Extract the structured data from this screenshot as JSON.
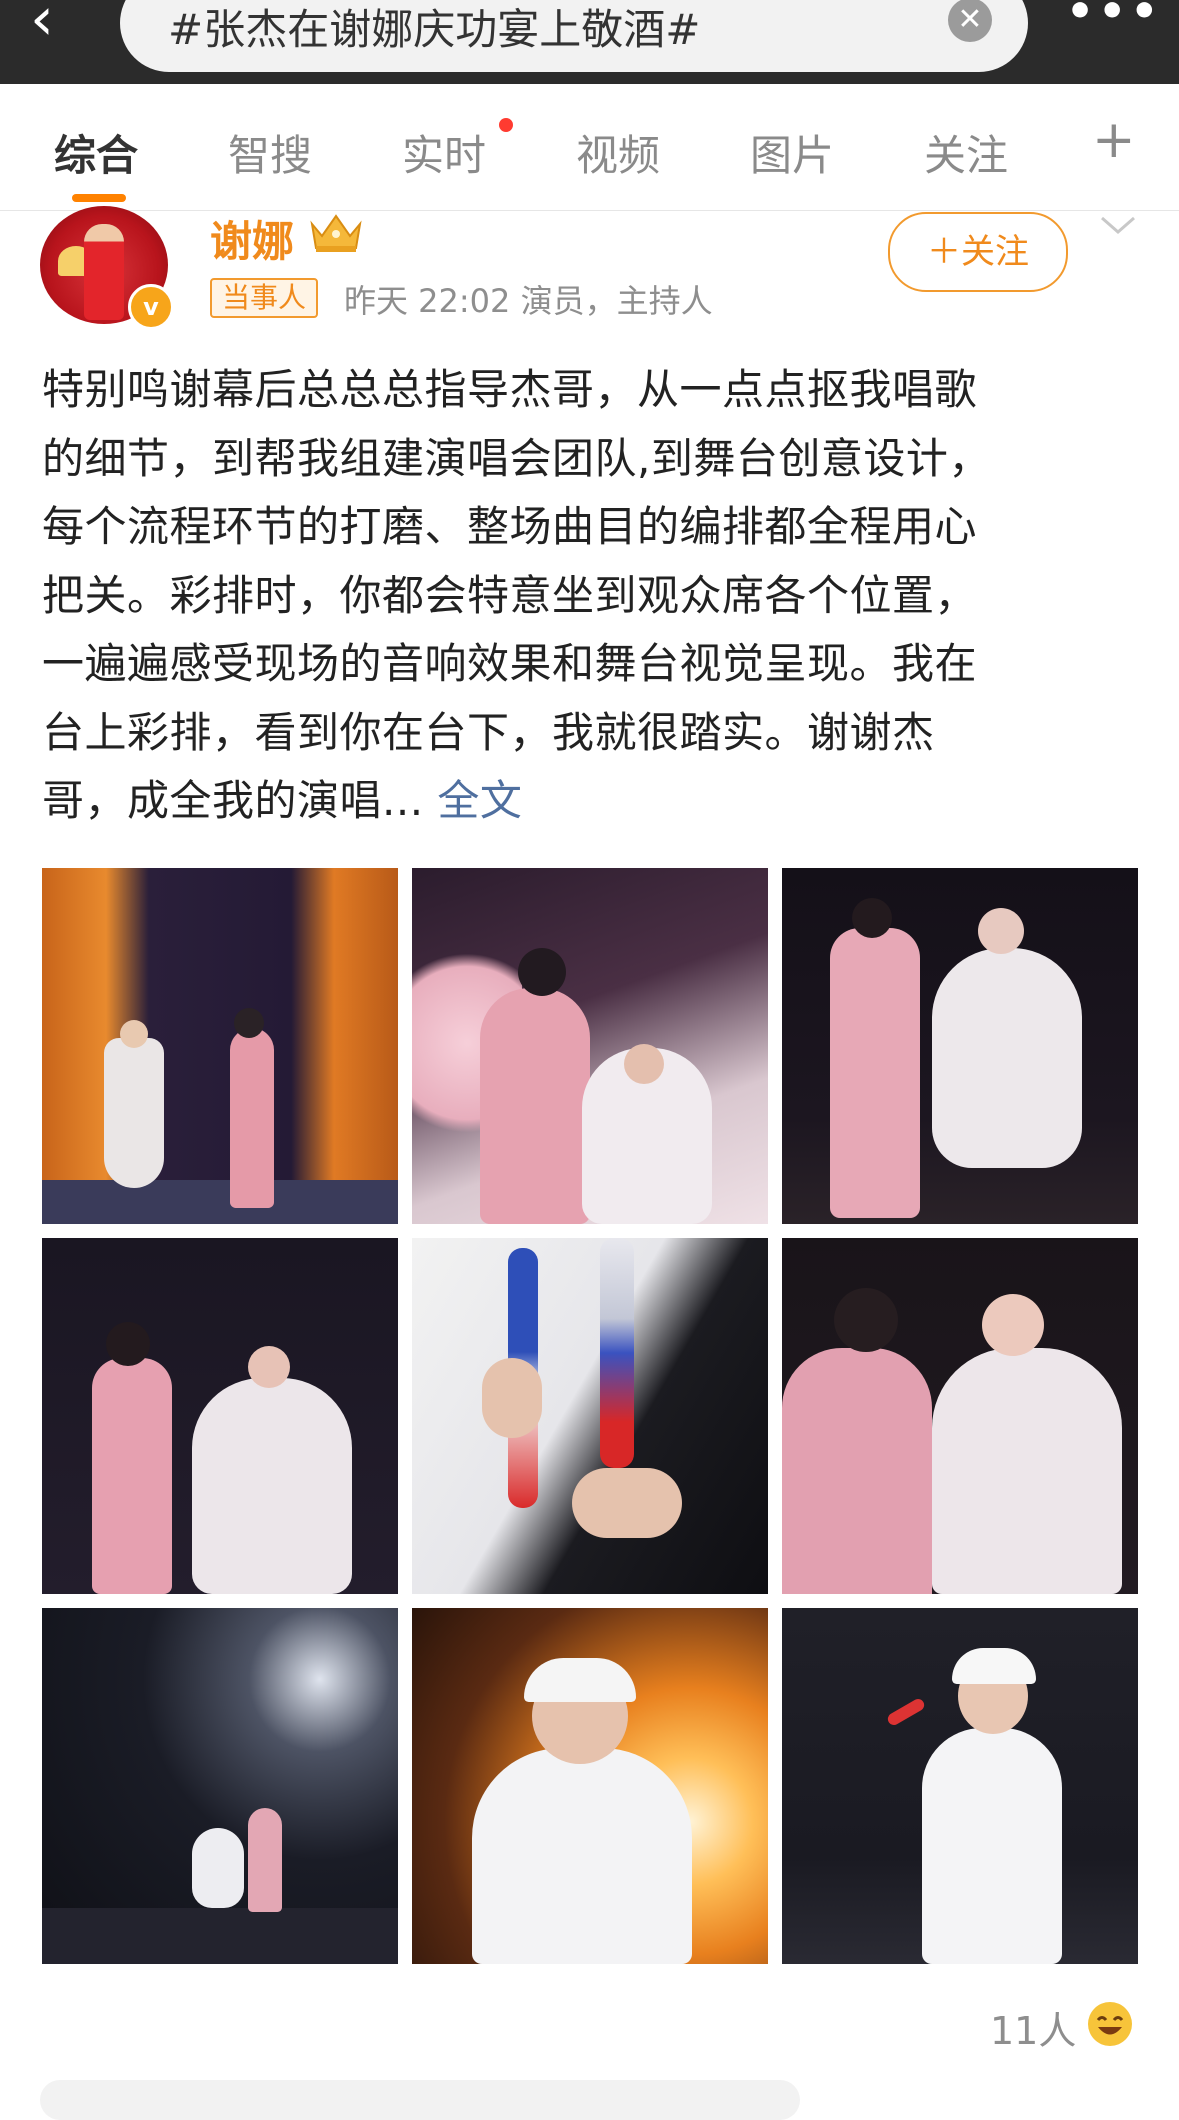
{
  "search": {
    "query": "#张杰在谢娜庆功宴上敬酒#",
    "back_glyph": "‹",
    "clear_glyph": "✕",
    "more_glyph": "•••"
  },
  "tabs": {
    "items": [
      {
        "label": "综合"
      },
      {
        "label": "智搜"
      },
      {
        "label": "实时"
      },
      {
        "label": "视频"
      },
      {
        "label": "图片"
      },
      {
        "label": "关注"
      }
    ],
    "plus_glyph": "+"
  },
  "post": {
    "user_name": "谢娜",
    "role_tag": "当事人",
    "meta": "昨天 22:02  演员，主持人",
    "follow_label": "＋关注",
    "verified_glyph": "v",
    "text_lines": [
      "特别鸣谢幕后总总总指导杰哥，从一点点抠我唱歌",
      "的细节，到帮我组建演唱会团队,到舞台创意设计，",
      "每个流程环节的打磨、整场曲目的编排都全程用心",
      "把关。彩排时，你都会特意坐到观众席各个位置，",
      "一遍遍感受现场的音响效果和舞台视觉呈现。我在",
      "台上彩排，看到你在台下，我就很踏实。谢谢杰"
    ],
    "last_line": "哥，成全我的演唱... ",
    "full_text_label": "全文",
    "likes_label": "11人"
  },
  "colors": {
    "accent": "#ff8200",
    "brand_orange": "#f08a1c",
    "link_blue": "#4f6f9f",
    "header_dark": "#2b2b2b"
  }
}
